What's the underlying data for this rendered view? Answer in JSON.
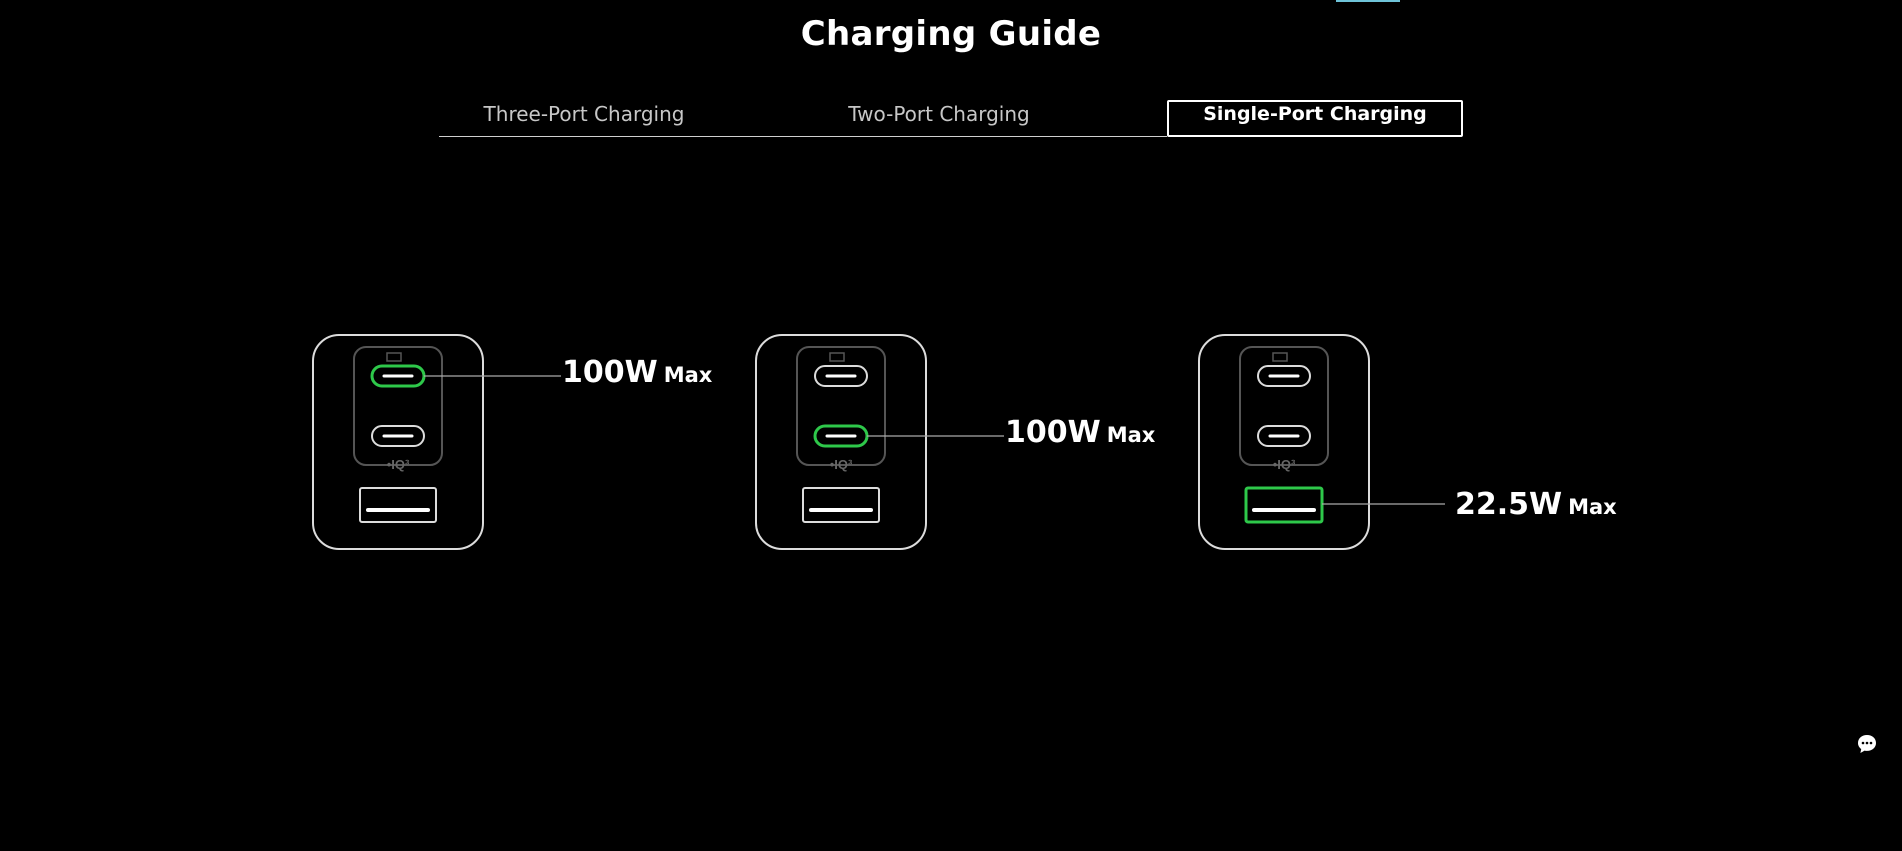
{
  "page": {
    "title": "Charging Guide"
  },
  "tabs": [
    {
      "label": "Three-Port Charging",
      "active": false
    },
    {
      "label": "Two-Port Charging",
      "active": false
    },
    {
      "label": "Single-Port Charging",
      "active": true
    }
  ],
  "diagrams": [
    {
      "active_port": "usb-c-top",
      "watt": "100W",
      "max": "Max"
    },
    {
      "active_port": "usb-c-bottom",
      "watt": "100W",
      "max": "Max"
    },
    {
      "active_port": "usb-a",
      "watt": "22.5W",
      "max": "Max"
    }
  ],
  "charger": {
    "badge": "•IQ³"
  },
  "colors": {
    "background": "#000000",
    "active_port": "#2ec84a",
    "outline": "#dcdcdc",
    "accent": "#6ec3d8"
  },
  "icons": {
    "chat": "chat-bubble-icon"
  }
}
